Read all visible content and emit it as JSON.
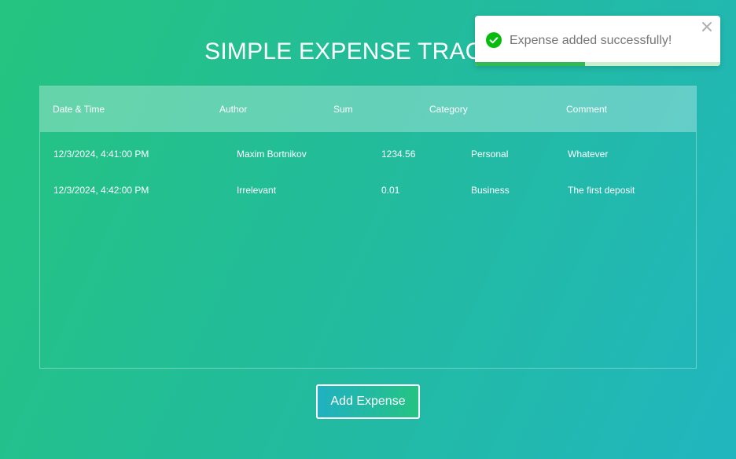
{
  "header": {
    "title": "SIMPLE EXPENSE TRACKER"
  },
  "table": {
    "columns": [
      "Date & Time",
      "Author",
      "Sum",
      "Category",
      "Comment"
    ],
    "rows": [
      [
        "12/3/2024, 4:41:00 PM",
        "Maxim Bortnikov",
        "1234.56",
        "Personal",
        "Whatever"
      ],
      [
        "12/3/2024, 4:42:00 PM",
        "Irrelevant",
        "0.01",
        "Business",
        "The first deposit"
      ]
    ]
  },
  "actions": {
    "add_label": "Add Expense"
  },
  "toast": {
    "message": "Expense added successfully!",
    "status": "success",
    "icon": "check-circle-icon",
    "close_icon": "close-icon",
    "progress_fraction": 0.45,
    "accent_color": "#07bc0c"
  },
  "colors": {
    "background_start": "#25c47f",
    "background_end": "#21b6bf"
  }
}
